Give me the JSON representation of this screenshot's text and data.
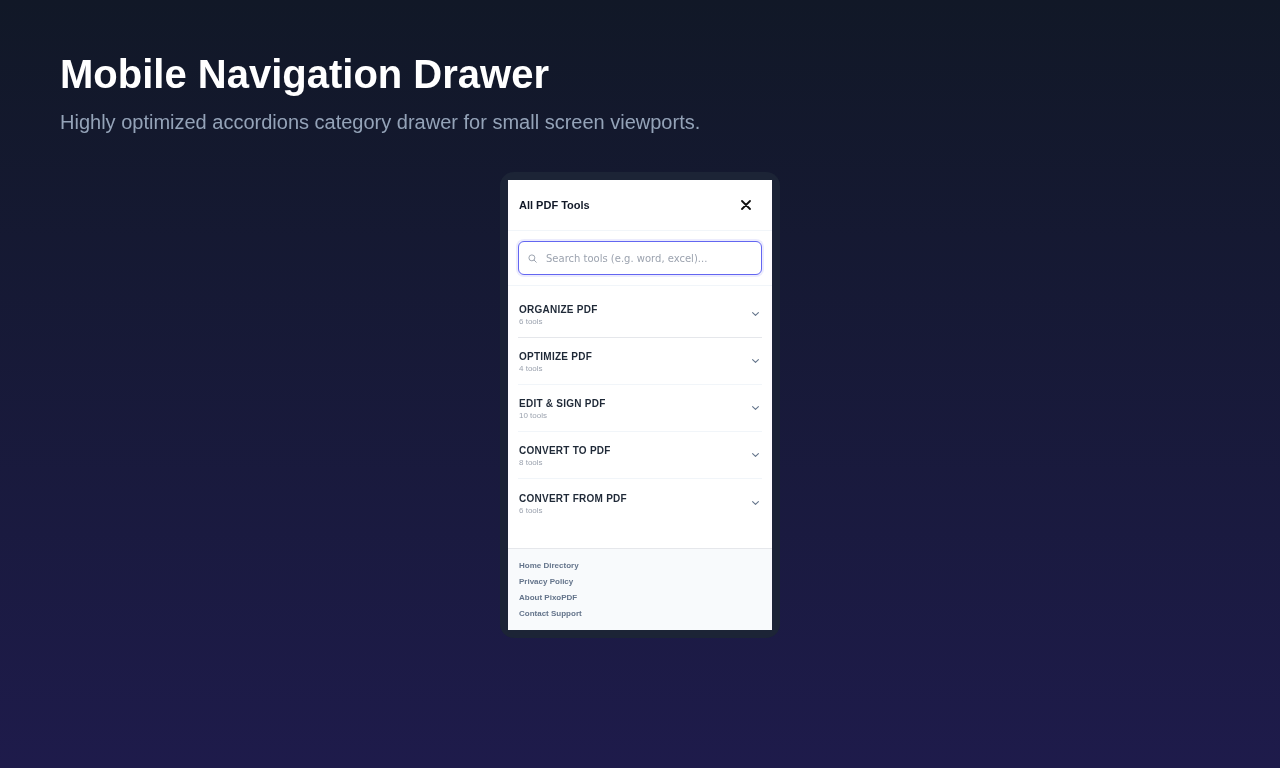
{
  "page": {
    "title": "Mobile Navigation Drawer",
    "subtitle": "Highly optimized accordions category drawer for small screen viewports."
  },
  "drawer": {
    "title": "All PDF Tools",
    "search": {
      "placeholder": "Search tools (e.g. word, excel)...",
      "focused": true
    },
    "categories": [
      {
        "name": "ORGANIZE PDF",
        "count": "6 tools",
        "expanded": false
      },
      {
        "name": "OPTIMIZE PDF",
        "count": "4 tools",
        "expanded": false
      },
      {
        "name": "EDIT & SIGN PDF",
        "count": "10 tools",
        "expanded": false
      },
      {
        "name": "CONVERT TO PDF",
        "count": "8 tools",
        "expanded": false
      },
      {
        "name": "CONVERT FROM PDF",
        "count": "6 tools",
        "expanded": false
      }
    ],
    "footer_links": [
      "Home Directory",
      "Privacy Policy",
      "About PixoPDF",
      "Contact Support"
    ]
  }
}
